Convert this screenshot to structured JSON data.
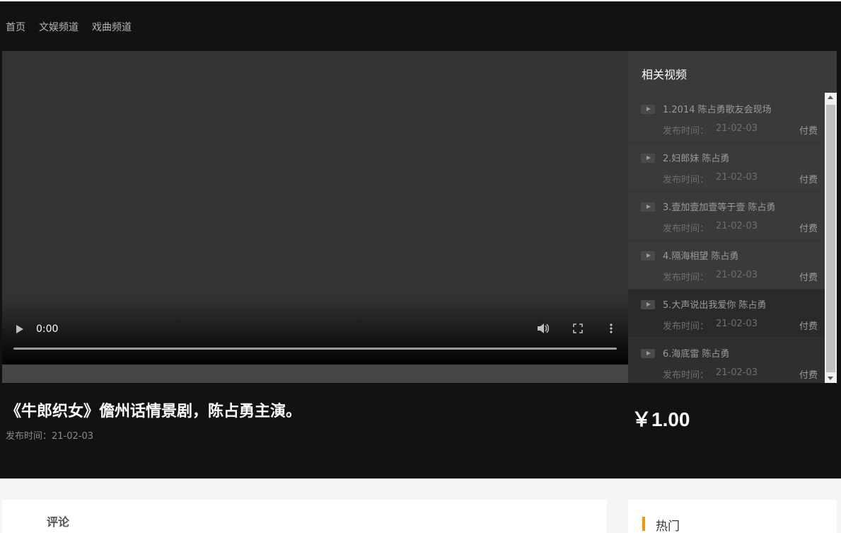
{
  "nav": {
    "items": [
      "首页",
      "文娱频道",
      "戏曲频道"
    ]
  },
  "player": {
    "time": "0:00"
  },
  "related": {
    "title": "相关视频",
    "date_label": "发布时间：",
    "items": [
      {
        "name": "1.2014 陈占勇歌友会现场",
        "date": "21-02-03",
        "status": "付费"
      },
      {
        "name": "2.妇郎妹 陈占勇",
        "date": "21-02-03",
        "status": "付费"
      },
      {
        "name": "3.壹加壹加壹等于壹 陈占勇",
        "date": "21-02-03",
        "status": "付费"
      },
      {
        "name": "4.隔海相望 陈占勇",
        "date": "21-02-03",
        "status": "付费"
      },
      {
        "name": "5.大声说出我爱你 陈占勇",
        "date": "21-02-03",
        "status": "付费"
      },
      {
        "name": "6.海底雷 陈占勇",
        "date": "21-02-03",
        "status": "付费"
      }
    ]
  },
  "video": {
    "title": "《牛郎织女》儋州话情景剧，陈占勇主演。",
    "date": "发布时间：21-02-03",
    "price": "￥1.00"
  },
  "comments": {
    "title": "评论"
  },
  "hot": {
    "title": "热门"
  },
  "colors": {
    "accent": "#f39800",
    "background": "#121212"
  }
}
